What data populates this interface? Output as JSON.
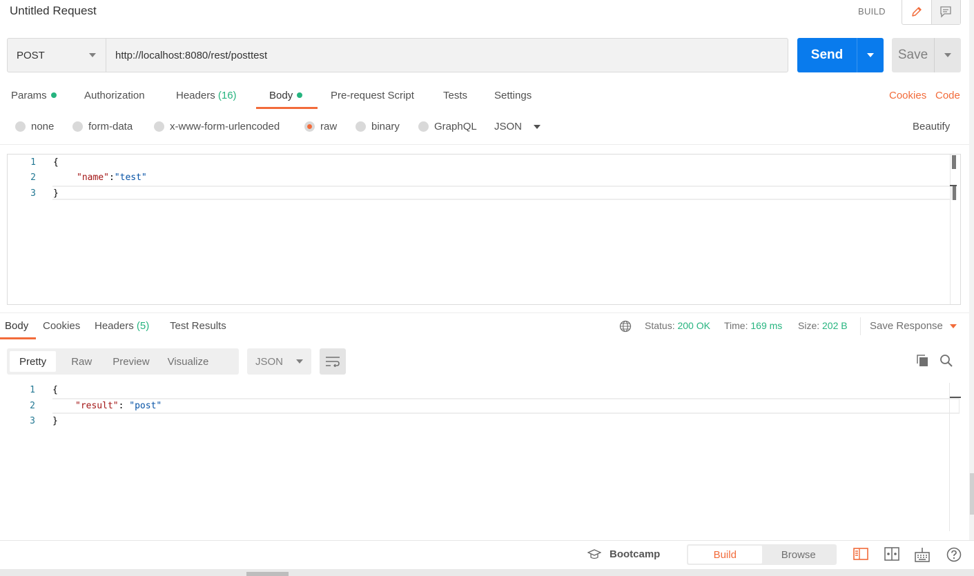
{
  "header": {
    "title": "Untitled Request",
    "build_label": "BUILD"
  },
  "request": {
    "method": "POST",
    "url": "http://localhost:8080/rest/posttest",
    "send_label": "Send",
    "save_label": "Save"
  },
  "request_tabs": {
    "params": "Params",
    "authorization": "Authorization",
    "headers": "Headers",
    "headers_count": "(16)",
    "body": "Body",
    "pre_request_script": "Pre-request Script",
    "tests": "Tests",
    "settings": "Settings",
    "cookies_link": "Cookies",
    "code_link": "Code"
  },
  "body_types": {
    "none": "none",
    "form_data": "form-data",
    "x_www_form_urlencoded": "x-www-form-urlencoded",
    "raw": "raw",
    "binary": "binary",
    "graphql": "GraphQL",
    "format": "JSON",
    "beautify": "Beautify",
    "selected": "raw"
  },
  "request_body": {
    "line_numbers": [
      "1",
      "2",
      "3"
    ],
    "open_brace": "{",
    "key": "\"name\"",
    "colon": ":",
    "value": "\"test\"",
    "close_brace": "}"
  },
  "response_tabs": {
    "body": "Body",
    "cookies": "Cookies",
    "headers": "Headers",
    "headers_count": "(5)",
    "test_results": "Test Results"
  },
  "response_meta": {
    "status_label": "Status:",
    "status_value": "200 OK",
    "time_label": "Time:",
    "time_value": "169 ms",
    "size_label": "Size:",
    "size_value": "202 B",
    "save_response": "Save Response"
  },
  "view_modes": {
    "pretty": "Pretty",
    "raw": "Raw",
    "preview": "Preview",
    "visualize": "Visualize",
    "format": "JSON"
  },
  "response_body": {
    "line_numbers": [
      "1",
      "2",
      "3"
    ],
    "open_brace": "{",
    "key": "\"result\"",
    "colon": ": ",
    "value": "\"post\"",
    "close_brace": "}"
  },
  "footer": {
    "bootcamp": "Bootcamp",
    "build": "Build",
    "browse": "Browse"
  },
  "colors": {
    "accent": "#f26b3a",
    "send_blue": "#097bed",
    "status_green": "#26b47f"
  }
}
